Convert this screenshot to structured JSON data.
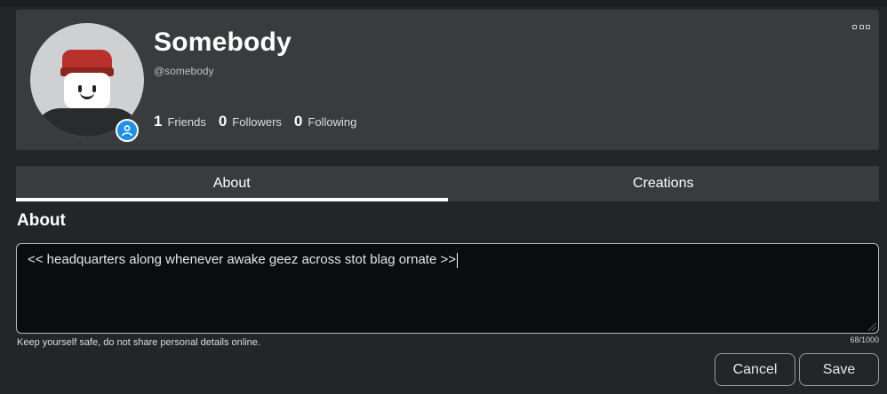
{
  "profile": {
    "display_name": "Somebody",
    "username": "@somebody",
    "stats": [
      {
        "count": "1",
        "label": "Friends"
      },
      {
        "count": "0",
        "label": "Followers"
      },
      {
        "count": "0",
        "label": "Following"
      }
    ],
    "more_icon": "ellipsis-icon",
    "status_icon": "person-icon",
    "accent_color": "#1e90e8"
  },
  "tabs": [
    {
      "label": "About",
      "active": true
    },
    {
      "label": "Creations",
      "active": false
    }
  ],
  "about": {
    "title": "About",
    "text": "<< headquarters along whenever awake geez across stot blag ornate >>",
    "safety_note": "Keep yourself safe, do not share personal details online.",
    "char_count": "68/1000"
  },
  "actions": {
    "cancel_label": "Cancel",
    "save_label": "Save"
  }
}
